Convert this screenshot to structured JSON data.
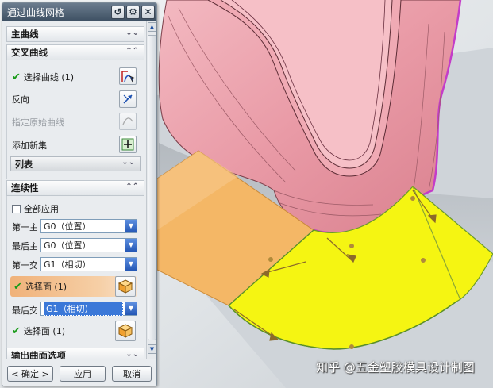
{
  "dialog": {
    "title": "通过曲线网格",
    "title_icons": [
      "reset-icon",
      "gear-icon",
      "close-icon"
    ]
  },
  "sections": {
    "primary_curves": {
      "label": "主曲线",
      "state": "collapsed"
    },
    "cross_curves": {
      "label": "交叉曲线",
      "select_curve": "选择曲线 (1)",
      "reverse": "反向",
      "specify_origin": "指定原始曲线",
      "add_new_set": "添加新集",
      "list": "列表"
    },
    "continuity": {
      "label": "连续性",
      "apply_all": "全部应用",
      "rows": [
        {
          "label": "第一主线串",
          "value": "G0（位置）"
        },
        {
          "label": "最后主线串",
          "value": "G0（位置）"
        },
        {
          "label": "第一交叉线串",
          "value": "G1（相切）"
        },
        {
          "label": "最后交叉线串",
          "value": "G1（相切）"
        }
      ],
      "select_face_1": "选择面 (1)",
      "select_face_2": "选择面 (1)"
    },
    "output_options": {
      "label": "输出曲面选项"
    }
  },
  "footer": {
    "ok": "< 确定 >",
    "apply": "应用",
    "cancel": "取消"
  },
  "watermark": "知乎 @五金塑胶模具设计制图",
  "colors": {
    "surface_pink": "#eba0ab",
    "patch_yellow": "#f5f512",
    "patch_orange": "#f4b766",
    "edge_magenta": "#c43cc8",
    "background": "#d7dde2"
  }
}
